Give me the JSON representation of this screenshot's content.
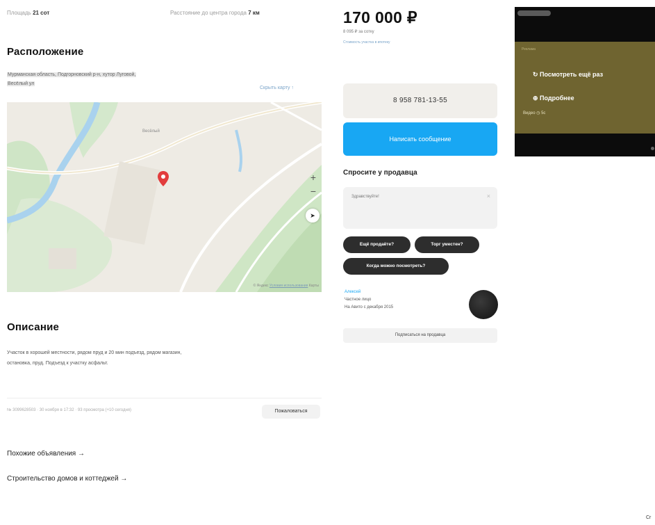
{
  "top_meta": {
    "area_label": "Площадь",
    "area_value": "21 сот",
    "distance_label": "Расстояние до центра города",
    "distance_value": "7 км"
  },
  "location": {
    "title": "Расположение",
    "address_line1": "Мурманская область, Подгорновский р-н, хутор Луговой,",
    "address_line2": "Весёлый ул",
    "show_map_link": "Скрыть карту ↑",
    "map_zoom_in": "+",
    "map_zoom_out": "−",
    "map_compass": "➤",
    "map_attr_brand": "© Яндекс",
    "map_attr_link": "Условия использования",
    "map_attr_tail": "Карты"
  },
  "description": {
    "title": "Описание",
    "text_line1": "Участок в хорошей местности, рядом пруд и 20 мин подъезд, рядом магазин,",
    "text_line2": "остановка, пруд. Подъезд к участку асфальт."
  },
  "ad_footer": {
    "meta": "№ 3099628503 · 30 ноября в 17:32 · 93 просмотра (+10 сегодня)",
    "report_button": "Пожаловаться"
  },
  "links": {
    "similar": "Похожие объявления →",
    "construction": "Строительство домов и коттеджей →"
  },
  "price": {
    "amount": "170 000 ₽",
    "per_unit": "8 095 ₽ за сотку",
    "link": "Стоимость участка в ипотеку"
  },
  "contact": {
    "phone": "8 958 781-13-55",
    "message_button": "Написать сообщение"
  },
  "ask": {
    "title": "Спросите у продавца",
    "placeholder": "Здравствуйте!",
    "clear_icon": "×",
    "chips": [
      "Ещё продаёте?",
      "Торг уместен?",
      "Когда можно посмотреть?"
    ]
  },
  "seller": {
    "name": "Алексей",
    "type": "Частное лицо",
    "since": "На Авито с декабря 2015",
    "subscribe_button": "Подписаться на продавца"
  },
  "video_ad": {
    "top_text": "Реклама",
    "replay_label": "↻ Посмотреть ещё раз",
    "more_label": "⊕ Подробнее",
    "ad_label": "Видео ◷ 5с"
  },
  "corner_text": "Cr",
  "colors": {
    "accent_blue": "#18a7f3",
    "chip_dark": "#2d2d2d",
    "video_overlay": "#6f6430"
  }
}
